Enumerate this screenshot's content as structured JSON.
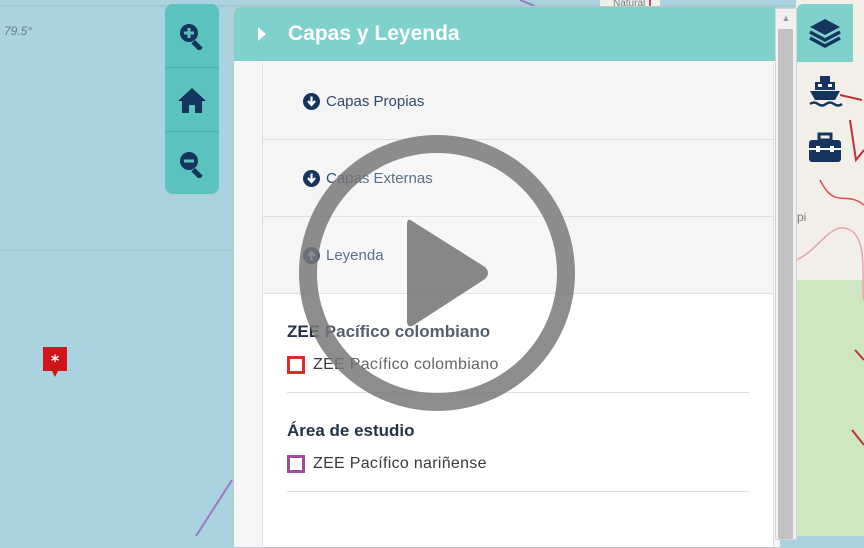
{
  "map": {
    "coordinate_label": "79.5°",
    "place_label": "Natural",
    "place_label_right": "pi",
    "water_color": "#aad3df",
    "land_color": "#f2efe9"
  },
  "zoom": {
    "buttons": [
      {
        "icon": "zoom-in-icon"
      },
      {
        "icon": "home-icon"
      },
      {
        "icon": "zoom-out-icon"
      }
    ]
  },
  "panel": {
    "title": "Capas y Leyenda",
    "sections": [
      {
        "label": "Capas Propias",
        "icon": "arrow-down-circle-icon"
      },
      {
        "label": "Capas Externas",
        "icon": "arrow-down-circle-icon"
      },
      {
        "label": "Leyenda",
        "icon": "arrow-up-circle-icon"
      }
    ],
    "legend_groups": [
      {
        "title": "ZEE Pacífico colombiano",
        "item": "ZEE Pacífico colombiano",
        "color": "#e02b2b"
      },
      {
        "title": "Área de estudio",
        "item": "ZEE Pacífico nariñense",
        "color": "#a04ea0"
      }
    ]
  },
  "side_toolbar": {
    "buttons": [
      {
        "icon": "layers-icon",
        "active": true
      },
      {
        "icon": "ship-icon",
        "active": false
      },
      {
        "icon": "toolbox-icon",
        "active": false
      }
    ]
  },
  "colors": {
    "accent": "#7fd1cc",
    "zoom_bar": "#5bc3bd",
    "icon_dark": "#15355f"
  },
  "overlay": {
    "icon": "play-icon"
  }
}
